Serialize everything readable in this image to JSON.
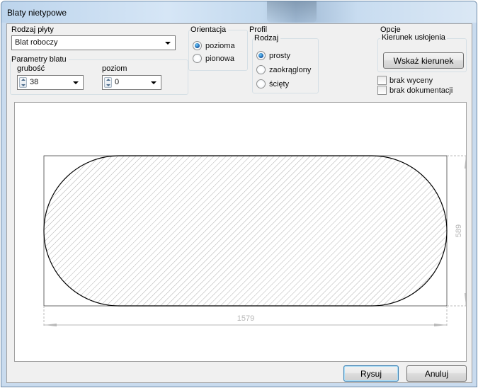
{
  "window": {
    "title": "Blaty nietypowe"
  },
  "rodzaj_plyty": {
    "label": "Rodzaj płyty",
    "value": "Blat roboczy"
  },
  "parametry": {
    "label": "Parametry blatu",
    "grubosc": {
      "label": "grubość",
      "value": "38"
    },
    "poziom": {
      "label": "poziom",
      "value": "0"
    }
  },
  "orientacja": {
    "label": "Orientacja",
    "options": [
      {
        "label": "pozioma",
        "selected": true
      },
      {
        "label": "pionowa",
        "selected": false
      }
    ]
  },
  "profil": {
    "label": "Profil",
    "rodzaj_label": "Rodzaj",
    "options": [
      {
        "label": "prosty",
        "selected": true
      },
      {
        "label": "zaokrąglony",
        "selected": false
      },
      {
        "label": "ścięty",
        "selected": false
      }
    ]
  },
  "opcje": {
    "label": "Opcje",
    "kierunek_label": "Kierunek usłojenia",
    "wskaz_button": "Wskaż kierunek",
    "brak_wyceny": {
      "label": "brak wyceny",
      "checked": false
    },
    "brak_dokumentacji": {
      "label": "brak dokumentacji",
      "checked": false
    }
  },
  "drawing": {
    "width_dim": "1579",
    "height_dim": "589",
    "shape": "stadium",
    "hatch_color": "#9a9a9a",
    "outline_color": "#000000",
    "dim_color": "#b8b8b8"
  },
  "buttons": {
    "rysuj": "Rysuj",
    "anuluj": "Anuluj"
  }
}
